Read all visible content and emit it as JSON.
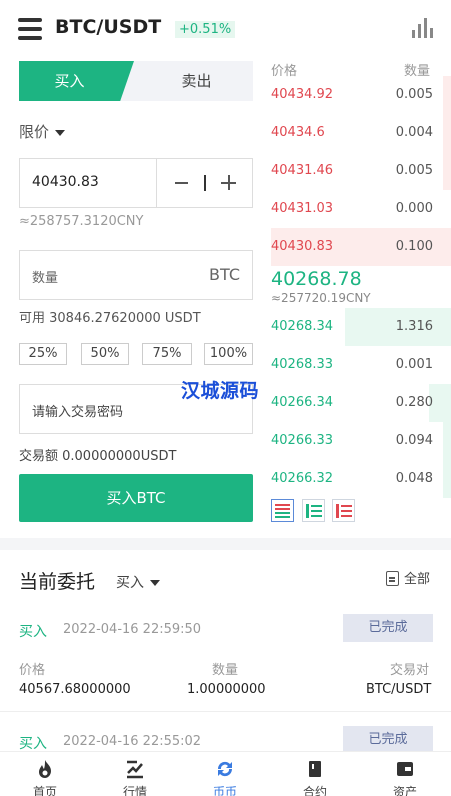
{
  "header": {
    "pair": "BTC/USDT",
    "change": "+0.51%"
  },
  "trade": {
    "buy_tab": "买入",
    "sell_tab": "卖出",
    "order_type": "限价",
    "price_value": "40430.83",
    "price_cny": "≈258757.3120CNY",
    "qty_placeholder": "数量",
    "qty_unit": "BTC",
    "available": "可用 30846.27620000 USDT",
    "percents": [
      "25%",
      "50%",
      "75%",
      "100%"
    ],
    "password_placeholder": "请输入交易密码",
    "amount": "交易额 0.00000000USDT",
    "buy_button": "买入BTC"
  },
  "watermark": "汉城源码",
  "orderbook": {
    "price_header": "价格",
    "qty_header": "数量",
    "asks": [
      {
        "price": "40434.92",
        "qty": "0.005"
      },
      {
        "price": "40434.6",
        "qty": "0.004"
      },
      {
        "price": "40431.46",
        "qty": "0.005"
      },
      {
        "price": "40431.03",
        "qty": "0.000"
      },
      {
        "price": "40430.83",
        "qty": "0.100"
      }
    ],
    "last_price": "40268.78",
    "last_price_cny": "≈257720.19CNY",
    "bids": [
      {
        "price": "40268.34",
        "qty": "1.316"
      },
      {
        "price": "40268.33",
        "qty": "0.001"
      },
      {
        "price": "40266.34",
        "qty": "0.280"
      },
      {
        "price": "40266.33",
        "qty": "0.094"
      },
      {
        "price": "40266.32",
        "qty": "0.048"
      }
    ]
  },
  "orders": {
    "title": "当前委托",
    "filter": "买入",
    "all": "全部",
    "price_label": "价格",
    "qty_label": "数量",
    "pair_label": "交易对",
    "items": [
      {
        "side": "买入",
        "time": "2022-04-16 22:59:50",
        "status": "已完成",
        "price": "40567.68000000",
        "qty": "1.00000000",
        "pair": "BTC/USDT"
      },
      {
        "side": "买入",
        "time": "2022-04-16 22:55:02",
        "status": "已完成"
      }
    ]
  },
  "nav": [
    {
      "label": "首页",
      "icon": "fire-icon"
    },
    {
      "label": "行情",
      "icon": "trend-icon"
    },
    {
      "label": "币币",
      "icon": "exchange-icon"
    },
    {
      "label": "合约",
      "icon": "contract-icon"
    },
    {
      "label": "资产",
      "icon": "wallet-icon"
    }
  ],
  "colors": {
    "up": "#1db482",
    "down": "#e0474f",
    "nav_active": "#3a7be0"
  }
}
